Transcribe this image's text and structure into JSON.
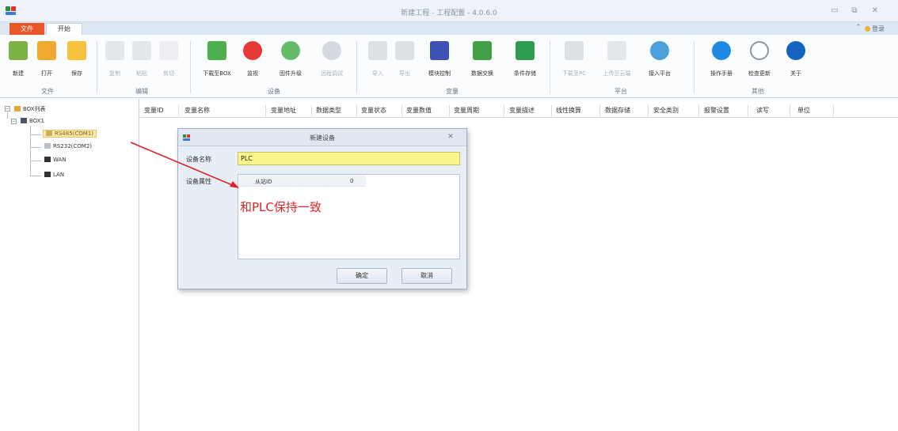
{
  "window": {
    "title": "新建工程 - 工程配置 - 4.0.6.0",
    "minimize_glyph": "▭",
    "restore_glyph": "⧉",
    "close_glyph": "✕"
  },
  "tabs": {
    "file": "文件",
    "home": "开始",
    "help_up_glyph": "⌃",
    "login": "登录"
  },
  "ribbon": {
    "file_group": {
      "label": "文件",
      "new": "新建",
      "open": "打开",
      "save": "保存"
    },
    "edit_group": {
      "label": "编辑",
      "copy": "复制",
      "paste": "粘贴",
      "cut": "剪切"
    },
    "device_group": {
      "label": "设备",
      "download_box": "下载至BOX",
      "monitor": "监视",
      "firmware_upgrade": "固件升级",
      "remote_debug": "远程调试"
    },
    "variable_group": {
      "label": "变量",
      "import": "导入",
      "export": "导出",
      "module_ctrl": "模块控制",
      "data_convert": "数据交换",
      "condition_store": "条件存储"
    },
    "platform_group": {
      "label": "平台",
      "download_pc": "下载至PC",
      "upload_platform": "上传至云端",
      "access_platform": "接入平台"
    },
    "other_group": {
      "label": "其他",
      "manual": "操作手册",
      "check_update": "检查更新",
      "about": "关于"
    }
  },
  "tree": {
    "root": "BOX列表",
    "box": "BOX1",
    "rs485": "RS485(COM1)",
    "rs232": "RS232(COM2)",
    "wan": "WAN",
    "lan": "LAN"
  },
  "grid": {
    "columns": [
      "变量ID",
      "变量名称",
      "变量地址",
      "数据类型",
      "变量状态",
      "变量数值",
      "变量周期",
      "变量描述",
      "线性换算",
      "数据存储",
      "安全类别",
      "报警设置",
      "读写",
      "单位"
    ]
  },
  "dialog": {
    "title": "新建设备",
    "name_label": "设备名称",
    "name_value": "PLC",
    "props_label": "设备属性",
    "prop_key": "从站ID",
    "prop_value": "0",
    "annotation": "和PLC保持一致",
    "ok": "确定",
    "cancel": "取消",
    "close_glyph": "✕"
  },
  "colors": {
    "annotation": "#d8262b",
    "file_tab": "#e8562a",
    "name_input_bg": "#fbf58a"
  }
}
